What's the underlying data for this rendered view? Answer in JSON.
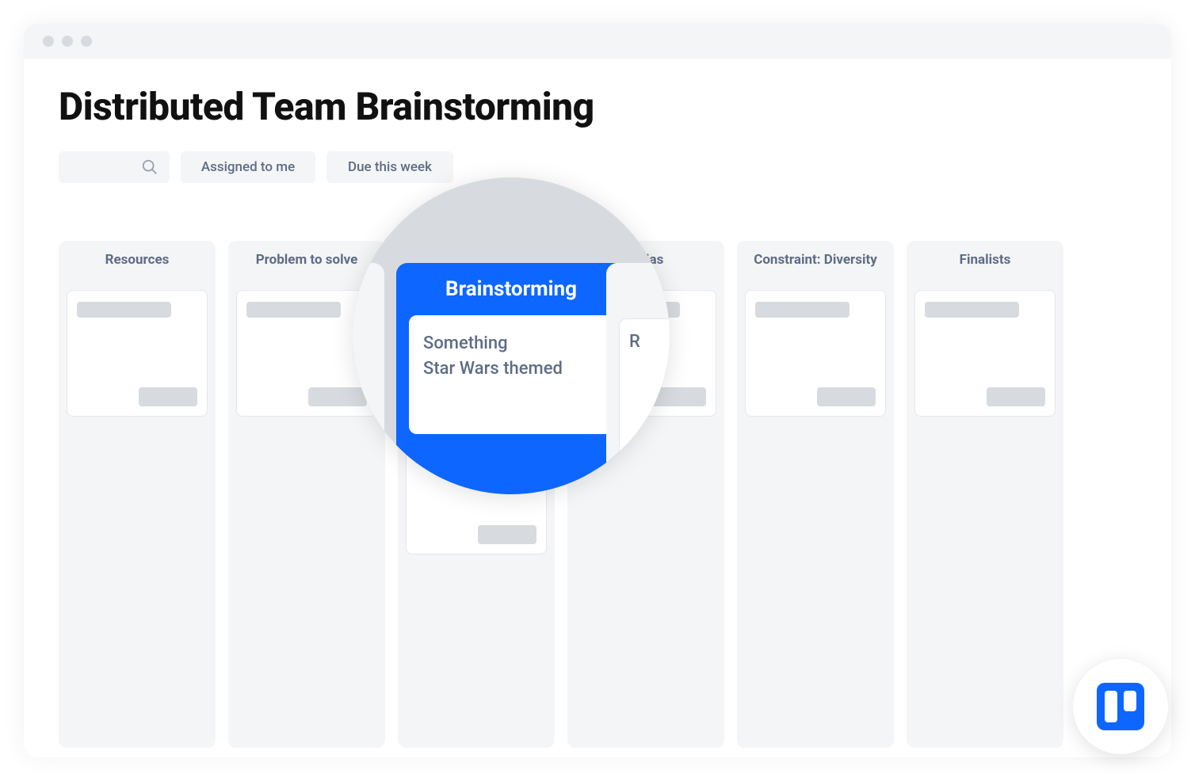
{
  "board": {
    "title": "Distributed Team Brainstorming"
  },
  "filters": {
    "search_placeholder": "",
    "assigned_label": "Assigned to me",
    "due_label": "Due this week"
  },
  "lists": [
    {
      "title": "Resources"
    },
    {
      "title": "Problem to solve"
    },
    {
      "title": "Brainstorming"
    },
    {
      "title": "Recency bias",
      "visible_fragment": "y bias"
    },
    {
      "title": "Constraint: Diversity"
    },
    {
      "title": "Finalists"
    }
  ],
  "magnifier": {
    "focused_list_title": "Brainstorming",
    "focused_card_line1": "Something",
    "focused_card_line2": "Star Wars themed",
    "right_peek_text": "R"
  },
  "colors": {
    "accent_blue": "#0d66ff",
    "list_bg": "#f4f5f7",
    "muted_text": "#5e6c84",
    "skeleton": "#d7dbe0"
  },
  "app": {
    "brand": "Trello"
  }
}
